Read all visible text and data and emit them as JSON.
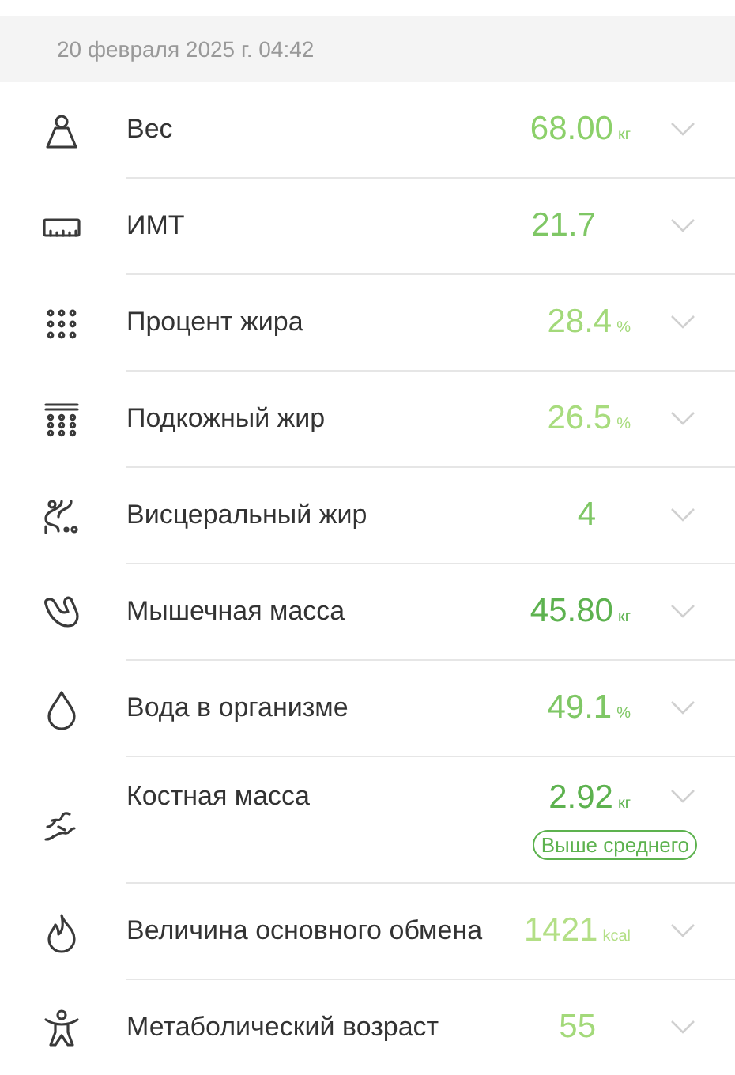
{
  "header": {
    "date": "20 февраля 2025 г. 04:42"
  },
  "metrics": [
    {
      "label": "Вес",
      "value": "68.00",
      "unit": "кг",
      "color": "#8cd06a"
    },
    {
      "label": "ИМТ",
      "value": "21.7",
      "color": "#7fc765"
    },
    {
      "label": "Процент жира",
      "value": "28.4",
      "unit": "%",
      "color": "#a3d97a"
    },
    {
      "label": "Подкожный жир",
      "value": "26.5",
      "unit": "%",
      "color": "#a8dc7e"
    },
    {
      "label": "Висцеральный жир",
      "value": "4",
      "color": "#7fc765"
    },
    {
      "label": "Мышечная масса",
      "value": "45.80",
      "unit": "кг",
      "color": "#5db24f"
    },
    {
      "label": "Вода в организме",
      "value": "49.1",
      "unit": "%",
      "color": "#7fc765"
    },
    {
      "label": "Костная масса",
      "value": "2.92",
      "unit": "кг",
      "color": "#5db24f",
      "badge": "Выше среднего"
    },
    {
      "label": "Величина основного обмена",
      "value": "1421",
      "unit": "kcal",
      "color": "#b3df86"
    },
    {
      "label": "Метаболический возраст",
      "value": "55",
      "color": "#a3d97a"
    }
  ]
}
